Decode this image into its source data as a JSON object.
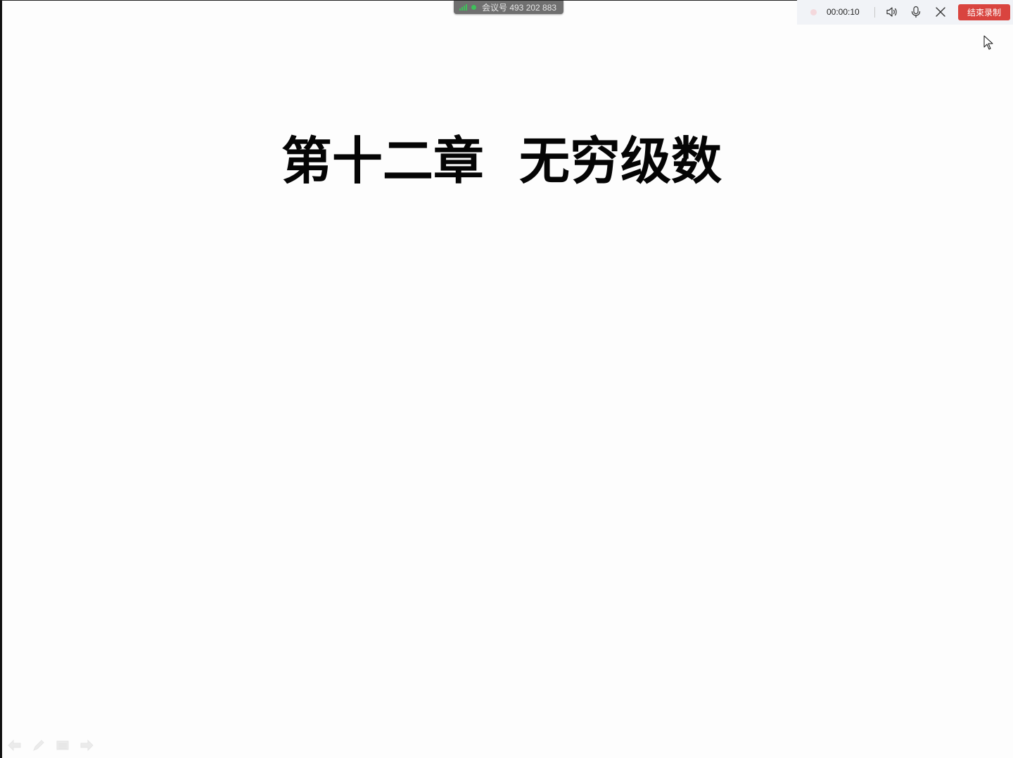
{
  "meeting": {
    "id_text": "会议号 493 202 883"
  },
  "recording": {
    "time": "00:00:10",
    "end_label": "结束录制"
  },
  "slide": {
    "title": "第十二章  无穷级数"
  },
  "icons": {
    "signal": "signal-icon",
    "status": "status-dot-icon",
    "record": "record-dot-icon",
    "speaker": "speaker-icon",
    "mic": "microphone-icon",
    "close": "close-icon",
    "cursor": "mouse-cursor-icon",
    "prev": "arrow-left-icon",
    "pen": "pen-icon",
    "menu": "menu-icon",
    "next": "arrow-right-icon"
  },
  "colors": {
    "end_button": "#d9443f",
    "signal_green": "#3ec15a",
    "toolbar_bg": "#f1f3f7"
  }
}
